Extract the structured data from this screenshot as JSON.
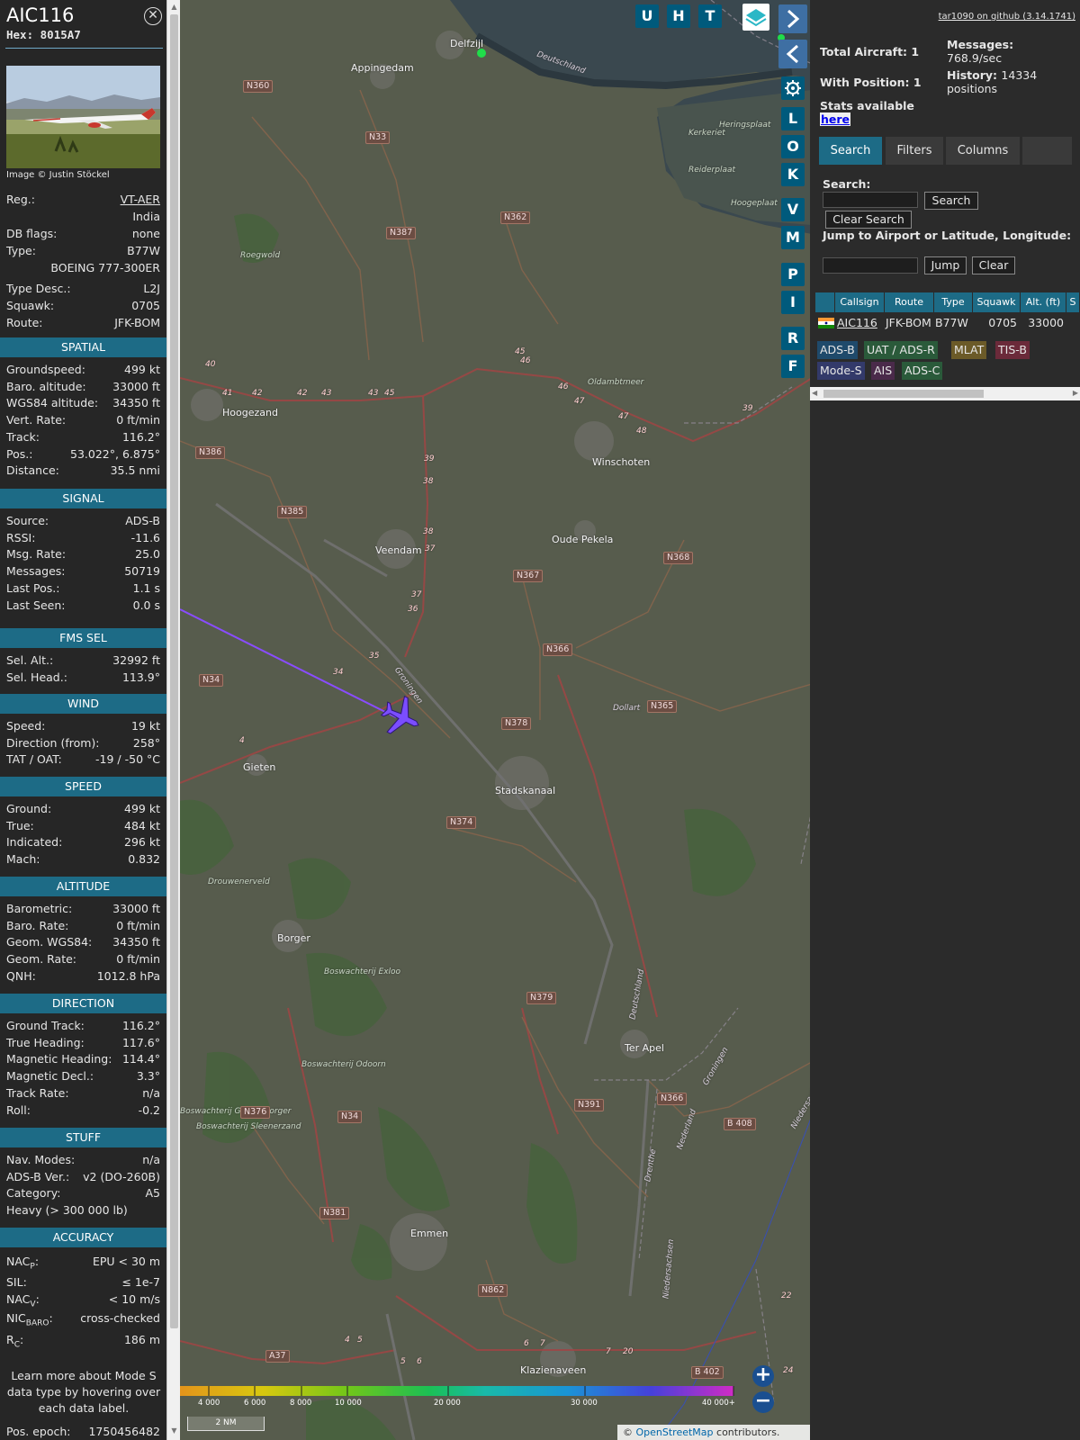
{
  "aircraft": {
    "callsign": "AIC116",
    "hex_label": "Hex:",
    "hex": "8015A7",
    "photo_credit": "Image © Justin Stöckel"
  },
  "info": {
    "reg_label": "Reg.:",
    "reg": "VT-AER",
    "country": "India",
    "dbflags_label": "DB flags:",
    "dbflags": "none",
    "type_label": "Type:",
    "type": "B77W",
    "type_full": "BOEING 777-300ER",
    "typedesc_label": "Type Desc.:",
    "typedesc": "L2J",
    "squawk_label": "Squawk:",
    "squawk": "0705",
    "route_label": "Route:",
    "route": "JFK-BOM"
  },
  "sections": {
    "spatial": "SPATIAL",
    "signal": "SIGNAL",
    "fms": "FMS SEL",
    "wind": "WIND",
    "speed": "SPEED",
    "altitude": "ALTITUDE",
    "direction": "DIRECTION",
    "stuff": "STUFF",
    "accuracy": "ACCURACY"
  },
  "spatial": [
    [
      "Groundspeed:",
      "499 kt"
    ],
    [
      "Baro. altitude:",
      "33000 ft"
    ],
    [
      "WGS84 altitude:",
      "34350 ft"
    ],
    [
      "Vert. Rate:",
      "0 ft/min"
    ],
    [
      "Track:",
      "116.2°"
    ],
    [
      "Pos.:",
      "53.022°, 6.875°"
    ],
    [
      "Distance:",
      "35.5 nmi"
    ]
  ],
  "signal": [
    [
      "Source:",
      "ADS-B"
    ],
    [
      "RSSI:",
      "-11.6"
    ],
    [
      "Msg. Rate:",
      "25.0"
    ],
    [
      "Messages:",
      "50719"
    ],
    [
      "Last Pos.:",
      "1.1 s"
    ],
    [
      "Last Seen:",
      "0.0 s"
    ]
  ],
  "fms": [
    [
      "Sel. Alt.:",
      "32992 ft"
    ],
    [
      "Sel. Head.:",
      "113.9°"
    ]
  ],
  "wind": [
    [
      "Speed:",
      "19 kt"
    ],
    [
      "Direction (from):",
      "258°"
    ],
    [
      "TAT / OAT:",
      "-19 / -50 °C"
    ]
  ],
  "speed": [
    [
      "Ground:",
      "499 kt"
    ],
    [
      "True:",
      "484 kt"
    ],
    [
      "Indicated:",
      "296 kt"
    ],
    [
      "Mach:",
      "0.832"
    ]
  ],
  "altitude": [
    [
      "Barometric:",
      "33000 ft"
    ],
    [
      "Baro. Rate:",
      "0 ft/min"
    ],
    [
      "Geom. WGS84:",
      "34350 ft"
    ],
    [
      "Geom. Rate:",
      "0 ft/min"
    ],
    [
      "QNH:",
      "1012.8 hPa"
    ]
  ],
  "direction": [
    [
      "Ground Track:",
      "116.2°"
    ],
    [
      "True Heading:",
      "117.6°"
    ],
    [
      "Magnetic Heading:",
      "114.4°"
    ],
    [
      "Magnetic Decl.:",
      "3.3°"
    ],
    [
      "Track Rate:",
      "n/a"
    ],
    [
      "Roll:",
      "-0.2"
    ]
  ],
  "stuff": [
    [
      "Nav. Modes:",
      "n/a"
    ],
    [
      "ADS-B Ver.:",
      "v2 (DO-260B)"
    ],
    [
      "Category:",
      "A5"
    ],
    [
      "Heavy (> 300 000 lb)",
      ""
    ]
  ],
  "accuracy": {
    "nacp_k": "NAC",
    "nacp_sub": "P",
    "nacp_v": "EPU < 30 m",
    "sil_k": "SIL:",
    "sil_v": "≤ 1e-7",
    "nacv_k": "NAC",
    "nacv_sub": "V",
    "nacv_v": "< 10 m/s",
    "nic_k": "NIC",
    "nic_sub": "BARO",
    "nic_v": "cross-checked",
    "rc_k": "R",
    "rc_sub": "C",
    "rc_v": "186 m"
  },
  "learn_more": "Learn more about Mode S data type by hovering over each data label.",
  "pos_epoch_label": "Pos. epoch:",
  "pos_epoch": "1750456482",
  "map": {
    "towns": [
      "Delfzijl",
      "Appingedam",
      "Hoogezand",
      "Winschoten",
      "Veendam",
      "Oude Pekela",
      "Stadskanaal",
      "Gieten",
      "Borger",
      "Ter Apel",
      "Emmen",
      "Klazienaveen",
      "Oldambtmeer",
      "Reiderplaat",
      "Kerkeriet",
      "Heringsplaat",
      "Hoogeplaat",
      "Roegwold",
      "Drouwenerveld",
      "Boswachterij Exloo",
      "Boswachterij Odoorn",
      "Boswachterij Sleenerzand",
      "Boswachterij Gieten Borger",
      "Groningen",
      "Deutschland",
      "Nederland",
      "Drenthe",
      "Niedersachsen",
      "Groningen",
      "Dollart",
      "Deutschland",
      "Niedersachsen"
    ],
    "roads": [
      "N360",
      "N33",
      "N362",
      "N387",
      "N386",
      "N385",
      "N367",
      "N368",
      "N366",
      "N34",
      "N378",
      "N365",
      "N374",
      "N379",
      "N391",
      "N366",
      "N376",
      "N34",
      "N381",
      "B 408",
      "N862",
      "A37",
      "B 402"
    ],
    "route_numbers": [
      "40",
      "41",
      "42",
      "42",
      "43",
      "43",
      "45",
      "45",
      "46",
      "46",
      "47",
      "47",
      "48",
      "39",
      "39",
      "38",
      "38",
      "37",
      "37",
      "36",
      "35",
      "34",
      "4",
      "4",
      "5",
      "5",
      "6",
      "6",
      "7",
      "7",
      "20",
      "22",
      "24"
    ],
    "buttons": [
      "U",
      "H",
      "T",
      "L",
      "O",
      "K",
      "V",
      "M",
      "P",
      "I",
      "R",
      "F"
    ],
    "scale_labels": [
      "4 000",
      "6 000",
      "8 000",
      "10 000",
      "20 000",
      "30 000",
      "40 000+"
    ],
    "scale_bar": "2 NM",
    "attribution_prefix": "©",
    "attribution_link": "OpenStreetMap",
    "attribution_suffix": " contributors."
  },
  "panel": {
    "github": "tar1090 on github (3.14.1741)",
    "total_label": "Total Aircraft:",
    "total": "1",
    "withpos_label": "With Position:",
    "withpos": "1",
    "messages_label": "Messages:",
    "messages": "768.9/sec",
    "history_label": "History:",
    "history": "14334 positions",
    "stats_label": "Stats available",
    "stats_link": "here",
    "tabs": [
      "Search",
      "Filters",
      "Columns"
    ],
    "search_label": "Search:",
    "search_btn": "Search",
    "clear_search_btn": "Clear Search",
    "jump_label": "Jump to Airport or Latitude, Longitude:",
    "jump_btn": "Jump",
    "clear_btn": "Clear",
    "columns": [
      "Callsign",
      "Route",
      "Type",
      "Squawk",
      "Alt. (ft)",
      "S"
    ],
    "rows": [
      {
        "callsign": "AIC116",
        "route": "JFK-BOM",
        "type": "B77W",
        "squawk": "0705",
        "alt": "33000"
      }
    ],
    "tags": [
      "ADS-B",
      "UAT / ADS-R",
      "MLAT",
      "TIS-B",
      "Mode-S",
      "AIS",
      "ADS-C"
    ],
    "colors": {
      "adsb": "#1f4a6b",
      "uat": "#2a5a3a",
      "mlat": "#6b5a28",
      "tisb": "#6b2a3a",
      "modes": "#333a6a",
      "ais": "#4a2a4a",
      "adsc": "#2a5a3a",
      "accent": "#1d6b86"
    }
  }
}
